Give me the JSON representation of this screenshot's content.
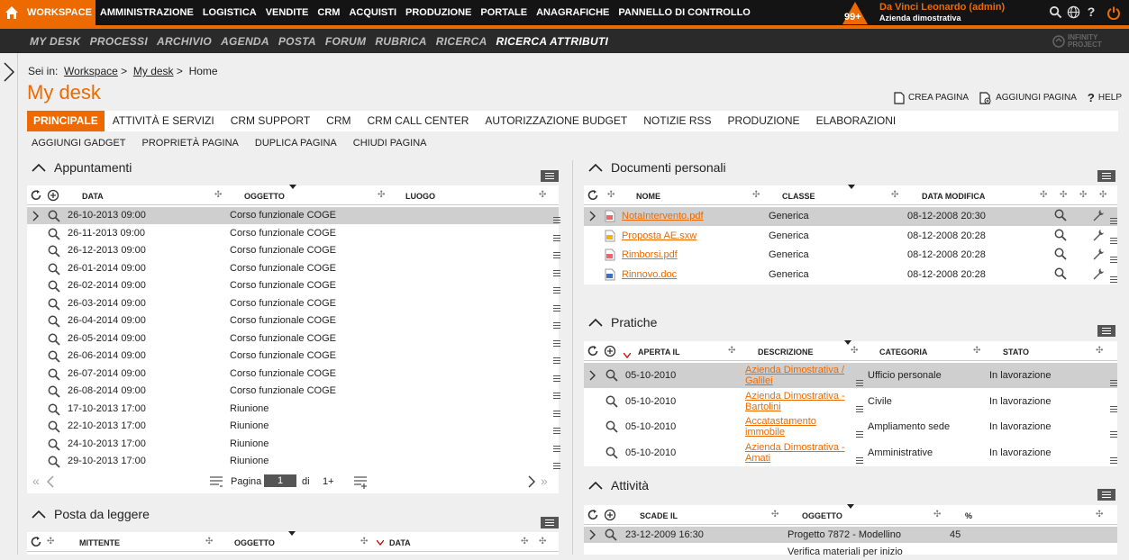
{
  "topnav": {
    "items": [
      "WORKSPACE",
      "AMMINISTRAZIONE",
      "LOGISTICA",
      "VENDITE",
      "CRM",
      "ACQUISTI",
      "PRODUZIONE",
      "PORTALE",
      "ANAGRAFICHE",
      "PANNELLO DI CONTROLLO"
    ],
    "active": "WORKSPACE",
    "notifications": "99+",
    "user_name": "Da Vinci Leonardo (admin)",
    "company": "Azienda dimostrativa"
  },
  "subnav": {
    "items": [
      "MY DESK",
      "PROCESSI",
      "ARCHIVIO",
      "AGENDA",
      "POSTA",
      "FORUM",
      "RUBRICA",
      "RICERCA",
      "RICERCA ATTRIBUTI"
    ],
    "active": "RICERCA ATTRIBUTI",
    "brand_line1": "INFINITY",
    "brand_line2": "PROJECT"
  },
  "breadcrumb": {
    "prefix": "Sei in:",
    "items": [
      "Workspace",
      "My desk",
      "Home"
    ],
    "sep": ">"
  },
  "page_title": "My desk",
  "page_actions": {
    "create": "CREA PAGINA",
    "add": "AGGIUNGI PAGINA",
    "help": "HELP"
  },
  "tabs": {
    "items": [
      "PRINCIPALE",
      "ATTIVITÀ E SERVIZI",
      "CRM SUPPORT",
      "CRM",
      "CRM CALL CENTER",
      "AUTORIZZAZIONE BUDGET",
      "NOTIZIE RSS",
      "PRODUZIONE",
      "ELABORAZIONI"
    ],
    "active": "PRINCIPALE"
  },
  "page_tools": [
    "AGGIUNGI GADGET",
    "PROPRIETÀ PAGINA",
    "DUPLICA PAGINA",
    "CHIUDI PAGINA"
  ],
  "appuntamenti": {
    "title": "Appuntamenti",
    "headers": [
      "DATA",
      "OGGETTO",
      "LUOGO"
    ],
    "rows": [
      [
        "26-10-2013 09:00",
        "Corso funzionale COGE"
      ],
      [
        "26-11-2013 09:00",
        "Corso funzionale COGE"
      ],
      [
        "26-12-2013 09:00",
        "Corso funzionale COGE"
      ],
      [
        "26-01-2014 09:00",
        "Corso funzionale COGE"
      ],
      [
        "26-02-2014 09:00",
        "Corso funzionale COGE"
      ],
      [
        "26-03-2014 09:00",
        "Corso funzionale COGE"
      ],
      [
        "26-04-2014 09:00",
        "Corso funzionale COGE"
      ],
      [
        "26-05-2014 09:00",
        "Corso funzionale COGE"
      ],
      [
        "26-06-2014 09:00",
        "Corso funzionale COGE"
      ],
      [
        "26-07-2014 09:00",
        "Corso funzionale COGE"
      ],
      [
        "26-08-2014 09:00",
        "Corso funzionale COGE"
      ],
      [
        "17-10-2013 17:00",
        "Riunione"
      ],
      [
        "22-10-2013 17:00",
        "Riunione"
      ],
      [
        "24-10-2013 17:00",
        "Riunione"
      ],
      [
        "29-10-2013 17:00",
        "Riunione"
      ]
    ],
    "pager": {
      "label": "Pagina",
      "page": "1",
      "of": "di",
      "total": "1+"
    }
  },
  "posta": {
    "title": "Posta da leggere",
    "headers": [
      "MITTENTE",
      "OGGETTO",
      "DATA"
    ]
  },
  "documenti": {
    "title": "Documenti personali",
    "headers": [
      "NOME",
      "CLASSE",
      "DATA MODIFICA"
    ],
    "rows": [
      [
        "NotaIntervento.pdf",
        "Generica",
        "08-12-2008 20:30"
      ],
      [
        "Proposta AE.sxw",
        "Generica",
        "08-12-2008 20:28"
      ],
      [
        "Rimborsi.pdf",
        "Generica",
        "08-12-2008 20:28"
      ],
      [
        "Rinnovo.doc",
        "Generica",
        "08-12-2008 20:28"
      ]
    ]
  },
  "pratiche": {
    "title": "Pratiche",
    "headers": [
      "APERTA IL",
      "DESCRIZIONE",
      "CATEGORIA",
      "STATO"
    ],
    "rows": [
      [
        "05-10-2010",
        "Azienda Dimostrativa /",
        "Galilei",
        "Ufficio personale",
        "In lavorazione"
      ],
      [
        "05-10-2010",
        "Azienda Dimostrativa -",
        "Bartolini",
        "Civile",
        "In lavorazione"
      ],
      [
        "05-10-2010",
        "Accatastamento",
        "immobile",
        "Ampliamento sede",
        "In lavorazione"
      ],
      [
        "05-10-2010",
        "Azienda Dimostrativa -",
        "Amati",
        "Amministrative",
        "In lavorazione"
      ]
    ]
  },
  "attivita": {
    "title": "Attività",
    "headers": [
      "SCADE IL",
      "OGGETTO",
      "%"
    ],
    "rows": [
      [
        "23-12-2009 16:30",
        "Progetto 7872 - Modellino",
        "45"
      ],
      [
        "",
        "Verifica materiali per inizio",
        ""
      ]
    ]
  }
}
